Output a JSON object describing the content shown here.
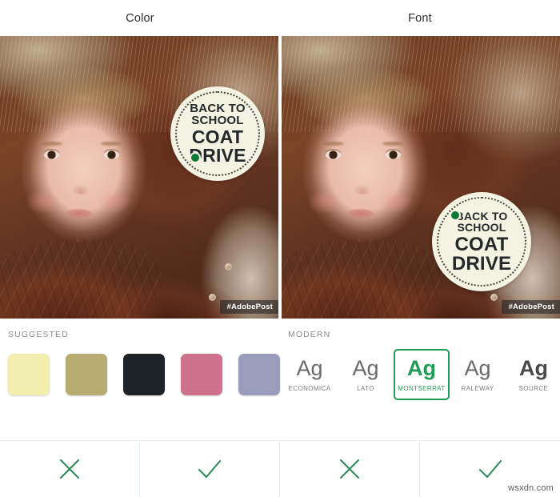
{
  "panels": [
    {
      "title": "Color"
    },
    {
      "title": "Font"
    }
  ],
  "artwork": {
    "badge_line1": "BACK TO",
    "badge_line2": "SCHOOL",
    "badge_line3": "COAT",
    "badge_line4": "DRIVE",
    "credit_tag": "#AdobePost"
  },
  "color_section": {
    "label": "SUGGESTED",
    "swatches": [
      {
        "name": "pale-yellow",
        "hex": "#F2EFAE"
      },
      {
        "name": "olive-khaki",
        "hex": "#B6AC71"
      },
      {
        "name": "near-black",
        "hex": "#1E2328"
      },
      {
        "name": "rose-pink",
        "hex": "#CE718C"
      },
      {
        "name": "periwinkle-grey",
        "hex": "#9A9CBC"
      }
    ]
  },
  "font_section": {
    "label": "MODERN",
    "sample_glyph": "Ag",
    "fonts": [
      {
        "name": "ECONOMICA",
        "selected": false
      },
      {
        "name": "LATO",
        "selected": false
      },
      {
        "name": "MONTSERRAT",
        "selected": true
      },
      {
        "name": "RALEWAY",
        "selected": false
      },
      {
        "name": "SOURCE",
        "selected": false
      }
    ],
    "selected_color": "#1F9D55"
  },
  "actions": [
    {
      "name": "reject-color",
      "icon": "close-icon"
    },
    {
      "name": "accept-color",
      "icon": "check-icon"
    },
    {
      "name": "reject-font",
      "icon": "close-icon"
    },
    {
      "name": "accept-font",
      "icon": "check-icon"
    }
  ],
  "action_color": "#2E8B57",
  "watermark": "wsxdn.com"
}
